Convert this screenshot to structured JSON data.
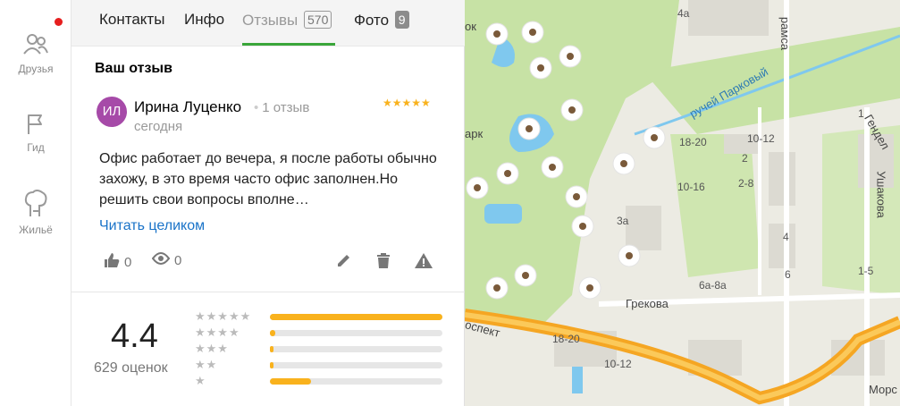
{
  "sidebar": {
    "items": [
      {
        "label": "Друзья",
        "icon": "friends-icon"
      },
      {
        "label": "Гид",
        "icon": "flag-icon"
      },
      {
        "label": "Жильё",
        "icon": "housing-icon"
      }
    ],
    "notification_color": "#e61e1e"
  },
  "tabs": [
    {
      "label": "Контакты"
    },
    {
      "label": "Инфо"
    },
    {
      "label": "Отзывы",
      "count": "570",
      "active": true
    },
    {
      "label": "Фото",
      "count": "9"
    }
  ],
  "review_section": {
    "title": "Ваш отзыв",
    "author": {
      "initials": "ИЛ",
      "name": "Ирина Луценко",
      "reviews_count": "1 отзыв",
      "avatar_color": "#a64aa8"
    },
    "date": "сегодня",
    "stars": 5,
    "text": "Офис работает до вечера, я после работы обычно захожу, в это время часто офис заполнен.Но решить свои вопросы вполне…",
    "read_more": "Читать целиком",
    "likes": "0",
    "views": "0"
  },
  "rating": {
    "value": "4.4",
    "count_label": "629 оценок",
    "distribution": [
      {
        "stars": 5,
        "fraction": 1.0
      },
      {
        "stars": 4,
        "fraction": 0.03
      },
      {
        "stars": 3,
        "fraction": 0.02
      },
      {
        "stars": 2,
        "fraction": 0.02
      },
      {
        "stars": 1,
        "fraction": 0.24
      }
    ],
    "accent": "#f9b21d"
  },
  "map": {
    "labels": [
      "ручей Парковый",
      "Грекова",
      "Ушакова",
      "Гендел",
      "рамса",
      "Морс",
      "оспект",
      "арк",
      "ок",
      "4а",
      "18-20",
      "10-12",
      "10-16",
      "2-8",
      "3а",
      "6а-8а",
      "1-5",
      "2",
      "4",
      "18-20",
      "10-12",
      "1",
      "6"
    ],
    "colors": {
      "park": "#c7e2a5",
      "road": "#f5a623",
      "water": "#7fc8ee",
      "land": "#ecebe3"
    }
  }
}
